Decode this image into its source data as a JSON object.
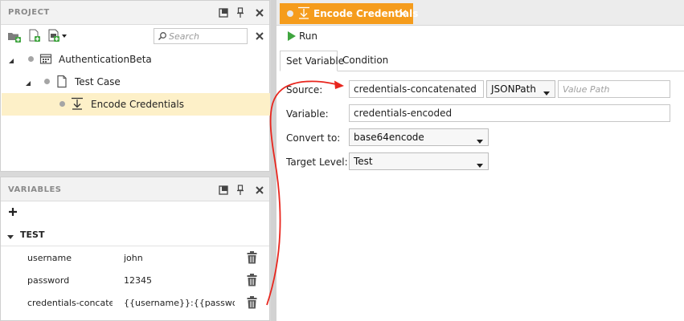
{
  "project_panel": {
    "title": "PROJECT",
    "search_placeholder": "Search",
    "tree": [
      {
        "label": "AuthenticationBeta"
      },
      {
        "label": "Test Case"
      },
      {
        "label": "Encode Credentials"
      }
    ]
  },
  "variables_panel": {
    "title": "VARIABLES",
    "group_label": "TEST",
    "variables": [
      {
        "name": "username",
        "value": "john"
      },
      {
        "name": "password",
        "value": "12345"
      },
      {
        "name": "credentials-concatenated",
        "value": "{{username}}:{{password}}"
      }
    ]
  },
  "editor": {
    "tab_label": "Encode Credentials",
    "run_label": "Run",
    "subtabs": [
      {
        "label": "Set Variable"
      },
      {
        "label": "Condition"
      }
    ],
    "form": {
      "source_label": "Source:",
      "source_value": "credentials-concatenated",
      "source_type": "JSONPath",
      "value_path_placeholder": "Value Path",
      "variable_label": "Variable:",
      "variable_value": "credentials-encoded",
      "convert_label": "Convert to:",
      "convert_value": "base64encode",
      "target_label": "Target Level:",
      "target_value": "Test"
    }
  },
  "colors": {
    "accent": "#f59c1c",
    "selection": "#fdf0c8",
    "annotation": "#e8261e"
  }
}
